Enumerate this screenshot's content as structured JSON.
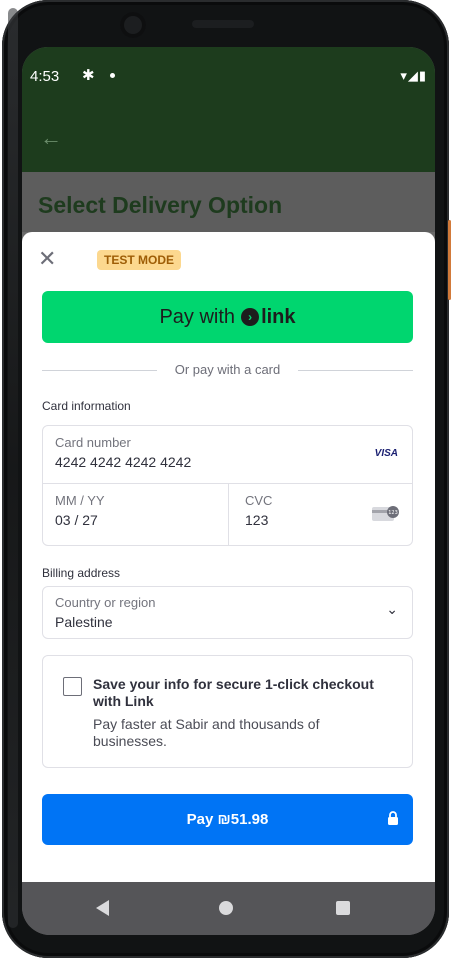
{
  "status_bar": {
    "time": "4:53",
    "icons": "▾◢▮"
  },
  "background_page": {
    "title": "Select Delivery Option"
  },
  "sheet": {
    "test_badge": "TEST MODE",
    "link_button": {
      "prefix": "Pay with",
      "brand": "link"
    },
    "divider_text": "Or pay with a card",
    "card_section_label": "Card information",
    "card_number": {
      "placeholder": "Card number",
      "value": "4242 4242 4242 4242",
      "brand": "VISA"
    },
    "expiry": {
      "placeholder": "MM / YY",
      "value": "03 / 27"
    },
    "cvc": {
      "placeholder": "CVC",
      "value": "123"
    },
    "billing_section_label": "Billing address",
    "country": {
      "placeholder": "Country or region",
      "value": "Palestine"
    },
    "save_info": {
      "title": "Save your info for secure 1-click checkout with Link",
      "description": "Pay faster at Sabir and thousands of businesses.",
      "checked": false
    },
    "pay_button": {
      "label": "Pay ₪51.98"
    }
  },
  "colors": {
    "link_green": "#00d66f",
    "pay_blue": "#0074f5",
    "app_bar": "#1d3c1d",
    "test_badge_bg": "#fcd88f"
  }
}
